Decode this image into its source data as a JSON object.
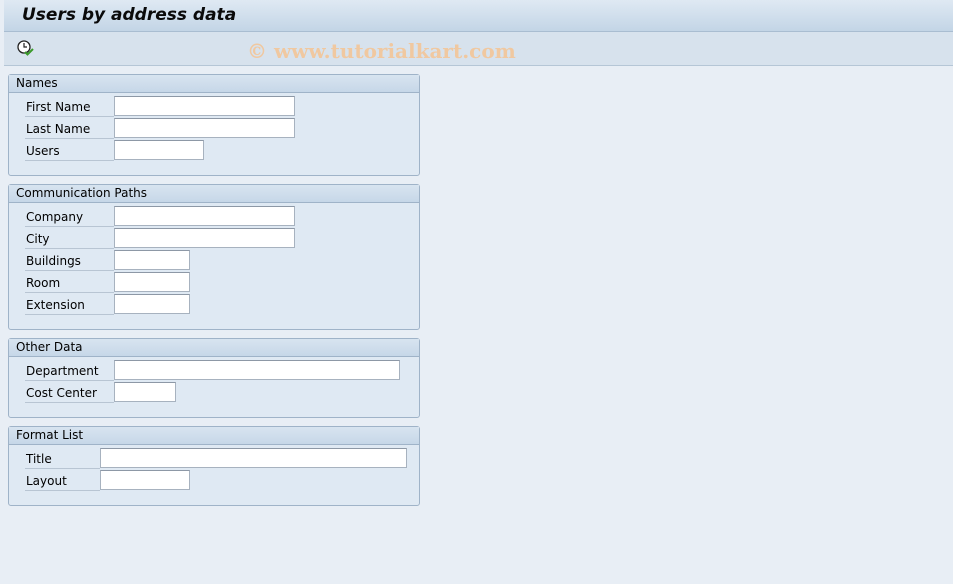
{
  "window": {
    "title": "Users by address data"
  },
  "toolbar": {
    "execute_icon": "clock-check-icon",
    "watermark": "© www.tutorialkart.com"
  },
  "groups": [
    {
      "title": "Names",
      "fields": [
        {
          "label": "First Name",
          "value": ""
        },
        {
          "label": "Last Name",
          "value": ""
        },
        {
          "label": "Users",
          "value": ""
        }
      ]
    },
    {
      "title": "Communication Paths",
      "fields": [
        {
          "label": "Company",
          "value": ""
        },
        {
          "label": "City",
          "value": ""
        },
        {
          "label": "Buildings",
          "value": ""
        },
        {
          "label": "Room",
          "value": ""
        },
        {
          "label": "Extension",
          "value": ""
        }
      ]
    },
    {
      "title": "Other Data",
      "fields": [
        {
          "label": "Department",
          "value": ""
        },
        {
          "label": "Cost Center",
          "value": ""
        }
      ]
    },
    {
      "title": "Format List",
      "fields": [
        {
          "label": "Title",
          "value": ""
        },
        {
          "label": "Layout",
          "value": ""
        }
      ]
    }
  ]
}
